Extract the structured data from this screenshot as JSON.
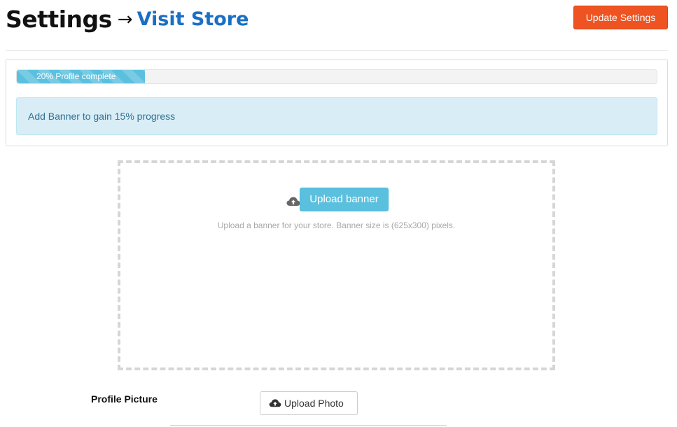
{
  "header": {
    "title": "Settings",
    "arrow": "→",
    "store_link": "Visit Store",
    "update_button": "Update Settings"
  },
  "progress": {
    "percent": 20,
    "label": "20% Profile complete",
    "hint": "Add Banner to gain 15% progress"
  },
  "banner": {
    "upload_button": "Upload banner",
    "hint": "Upload a banner for your store. Banner size is (625x300) pixels.",
    "icon": "cloud-upload-icon"
  },
  "profile": {
    "label": "Profile Picture",
    "upload_button": "Upload Photo",
    "icon": "cloud-upload-icon"
  },
  "colors": {
    "accent_orange": "#ee5321",
    "link_blue": "#1a6fc4",
    "info_blue": "#5bc0de",
    "alert_bg": "#d9edf7",
    "alert_text": "#31708f"
  }
}
